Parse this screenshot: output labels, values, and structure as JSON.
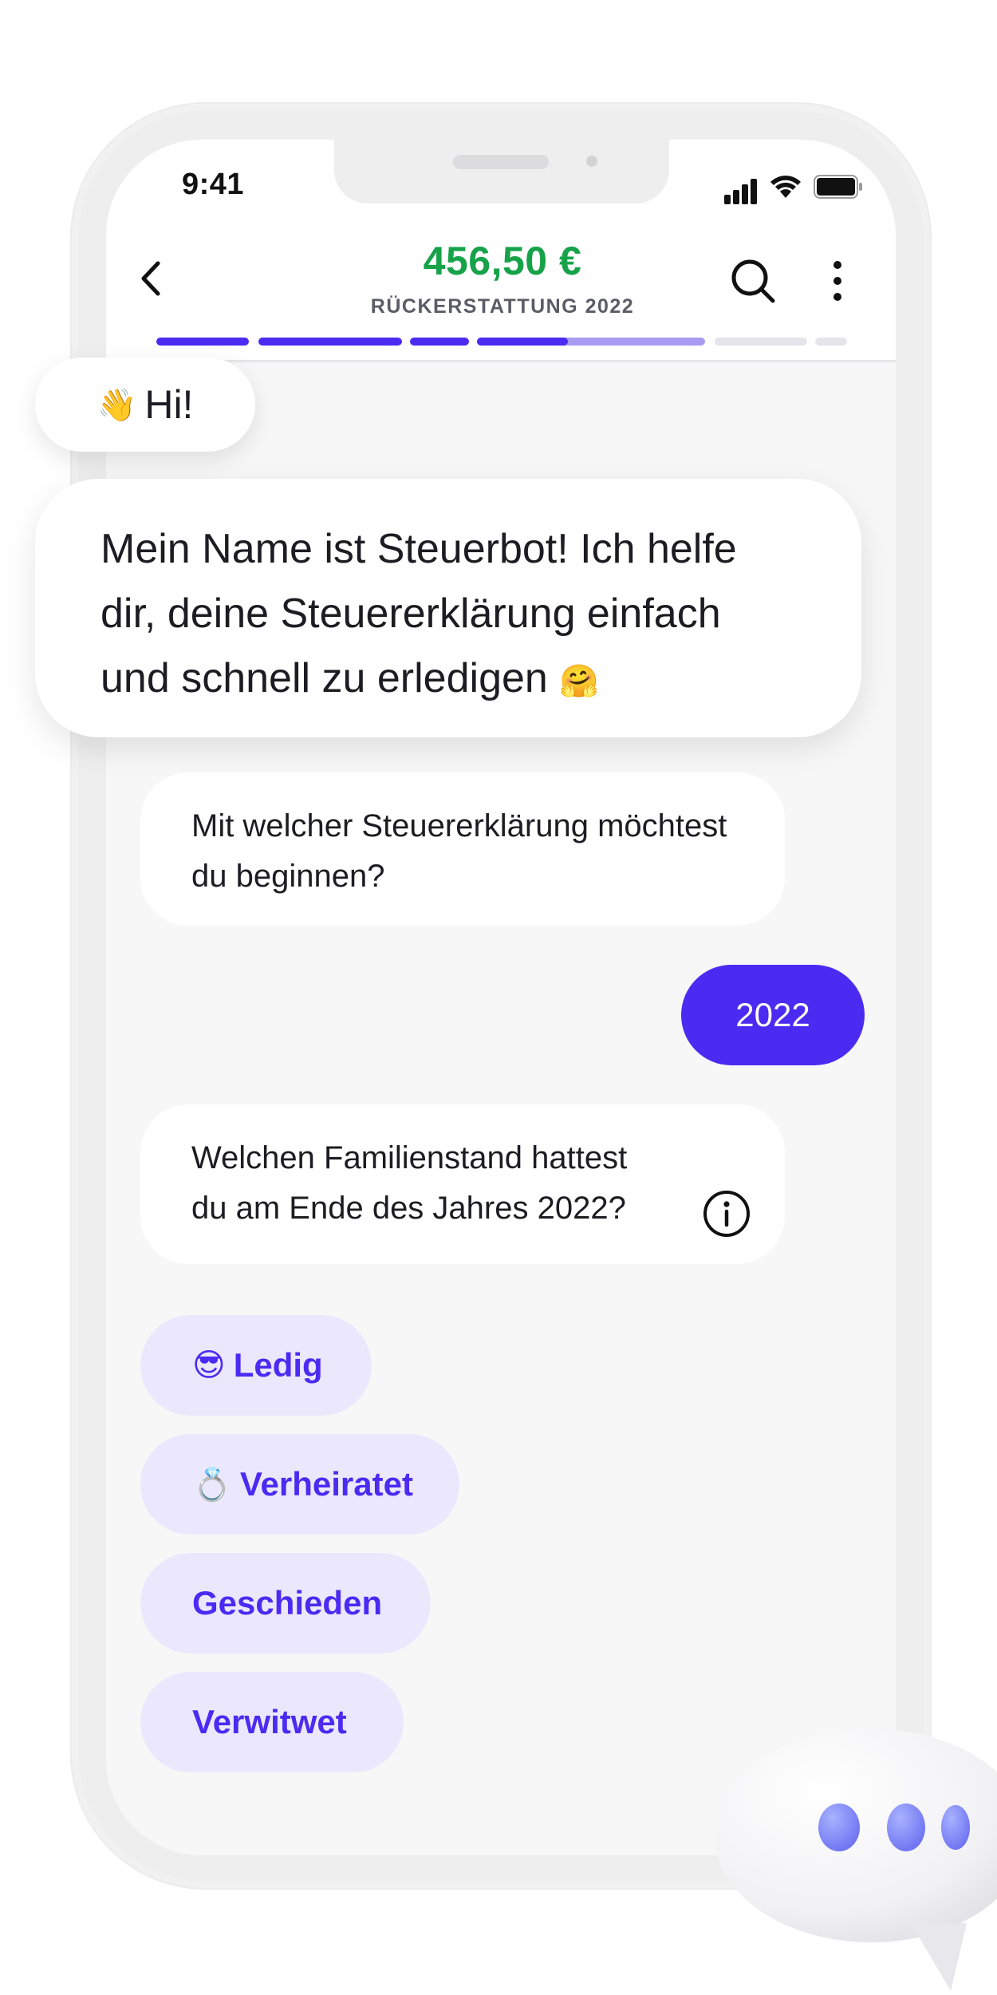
{
  "status_bar": {
    "time": "9:41"
  },
  "header": {
    "amount": "456,50 €",
    "subtitle": "RÜCKERSTATTUNG 2022",
    "back_icon": "chevron-left-icon",
    "search_icon": "search-icon",
    "more_icon": "more-vertical-icon"
  },
  "progress": {
    "segments": [
      1,
      1,
      1,
      0.4,
      0,
      0
    ],
    "colors": {
      "done": "#4b2bf2",
      "partial": "#a89cf2",
      "empty": "#e4e4ea"
    }
  },
  "chat": {
    "greeting": {
      "emoji": "👋",
      "text": "Hi!"
    },
    "intro": {
      "text": "Mein Name ist Steuerbot! Ich helfe dir, deine Steuererklärung einfach und schnell zu erledigen",
      "emoji": "🤗"
    },
    "question_1": "Mit welcher Steuererklärung möchtest du beginnen?",
    "answer_1": "2022",
    "question_2": "Welchen Familienstand hattest du am Ende des Jahres 2022?",
    "info_icon": "info-icon"
  },
  "options": [
    {
      "emoji": "😎",
      "label": "Ledig"
    },
    {
      "emoji": "💍",
      "label": "Verheiratet"
    },
    {
      "emoji": "",
      "label": "Geschieden"
    },
    {
      "emoji": "",
      "label": "Verwitwet"
    }
  ],
  "colors": {
    "accent": "#4b2bf2",
    "money": "#17a24a",
    "option_bg": "#ebe8fd"
  },
  "typing_indicator_icon": "typing-bubble-icon"
}
